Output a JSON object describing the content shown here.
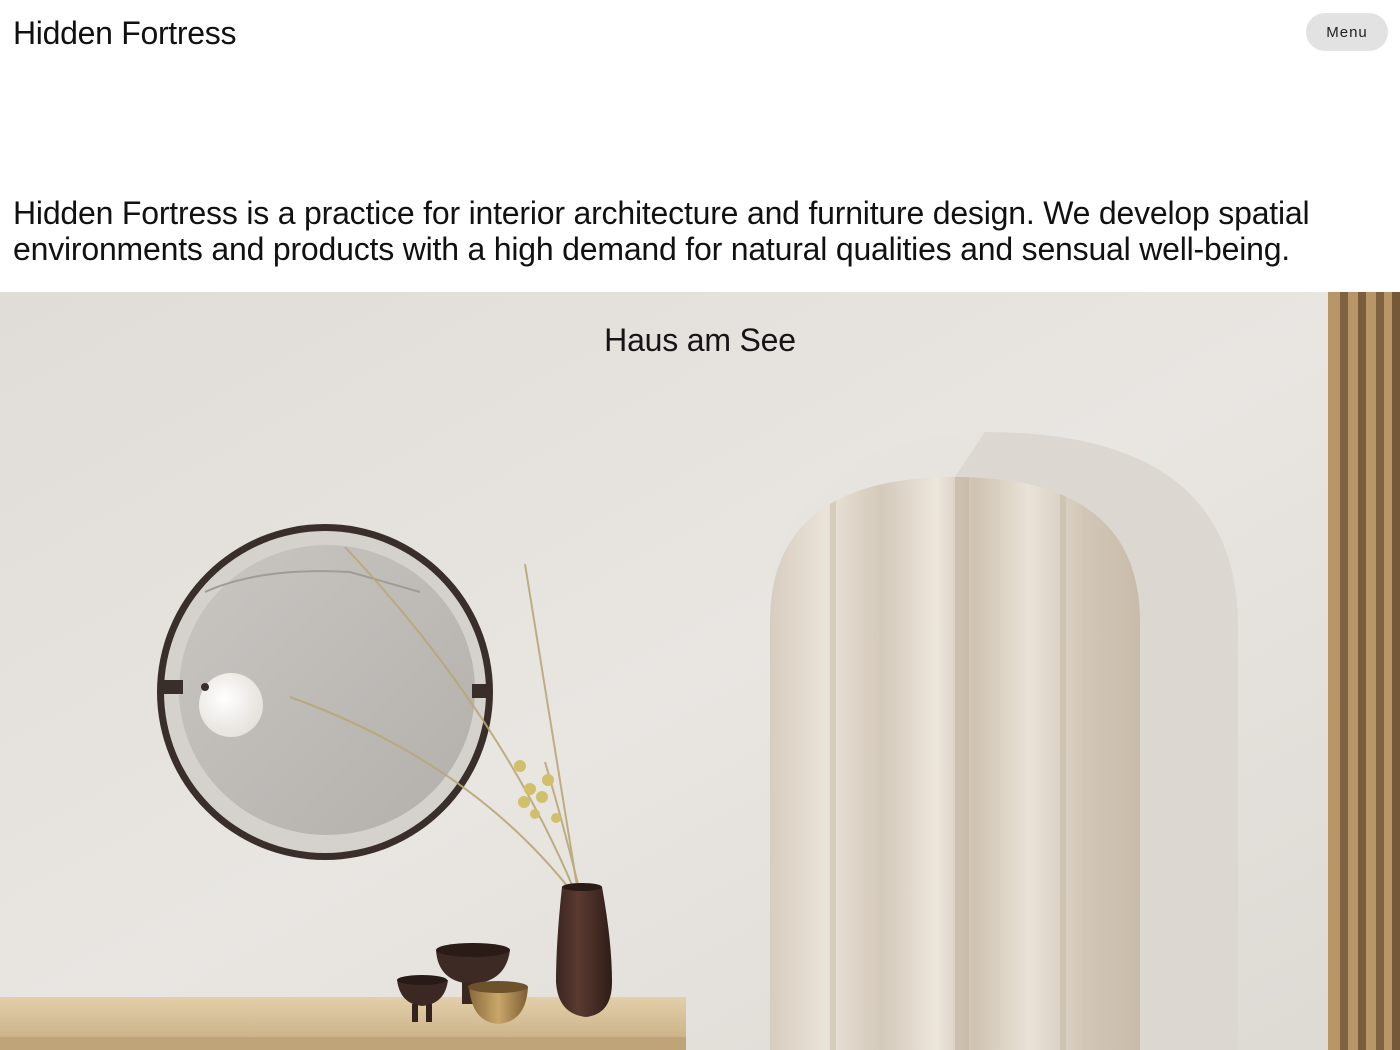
{
  "header": {
    "logo": "Hidden Fortress",
    "menu_label": "Menu"
  },
  "intro": {
    "text": "Hidden Fortress is a practice for interior architecture and furniture design. We develop spatial environments and products with a high demand for natural qualities and sensual well-being."
  },
  "featured_project": {
    "title": "Haus am See"
  },
  "colors": {
    "background": "#ffffff",
    "text": "#111111",
    "menu_button_bg": "#e2e2e2",
    "wall": "#e4e1dd",
    "shelf_wood": "#d9c29a",
    "mirror_frame": "#3a2e2a",
    "curtain": "#d8ccbb"
  }
}
